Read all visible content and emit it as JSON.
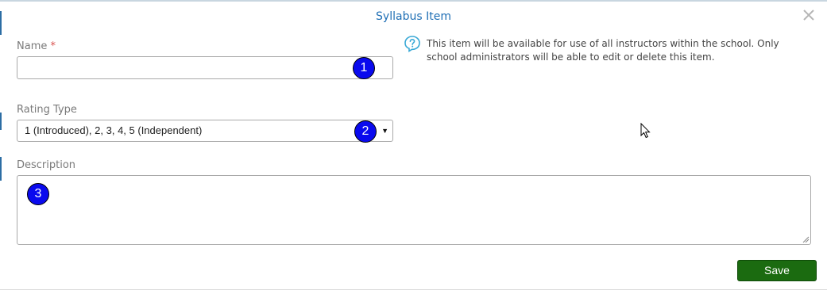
{
  "dialog": {
    "title": "Syllabus Item",
    "close_icon": "close-icon"
  },
  "form": {
    "name": {
      "label": "Name",
      "required_marker": "*",
      "value": "",
      "badge": "1"
    },
    "rating_type": {
      "label": "Rating Type",
      "selected": "1 (Introduced), 2, 3, 4, 5 (Independent)",
      "arrow": "▼",
      "badge": "2"
    },
    "description": {
      "label": "Description",
      "value": "",
      "badge": "3"
    }
  },
  "info": {
    "icon": "question-bubble-icon",
    "text": "This item will be available for use of all instructors within the school. Only school administrators will be able to edit or delete this item."
  },
  "actions": {
    "save_label": "Save"
  },
  "colors": {
    "title": "#1f6fb5",
    "required": "#d9534f",
    "save_button": "#1b6b10",
    "badge": "#0a0aee",
    "info_icon": "#3aa9d6"
  }
}
